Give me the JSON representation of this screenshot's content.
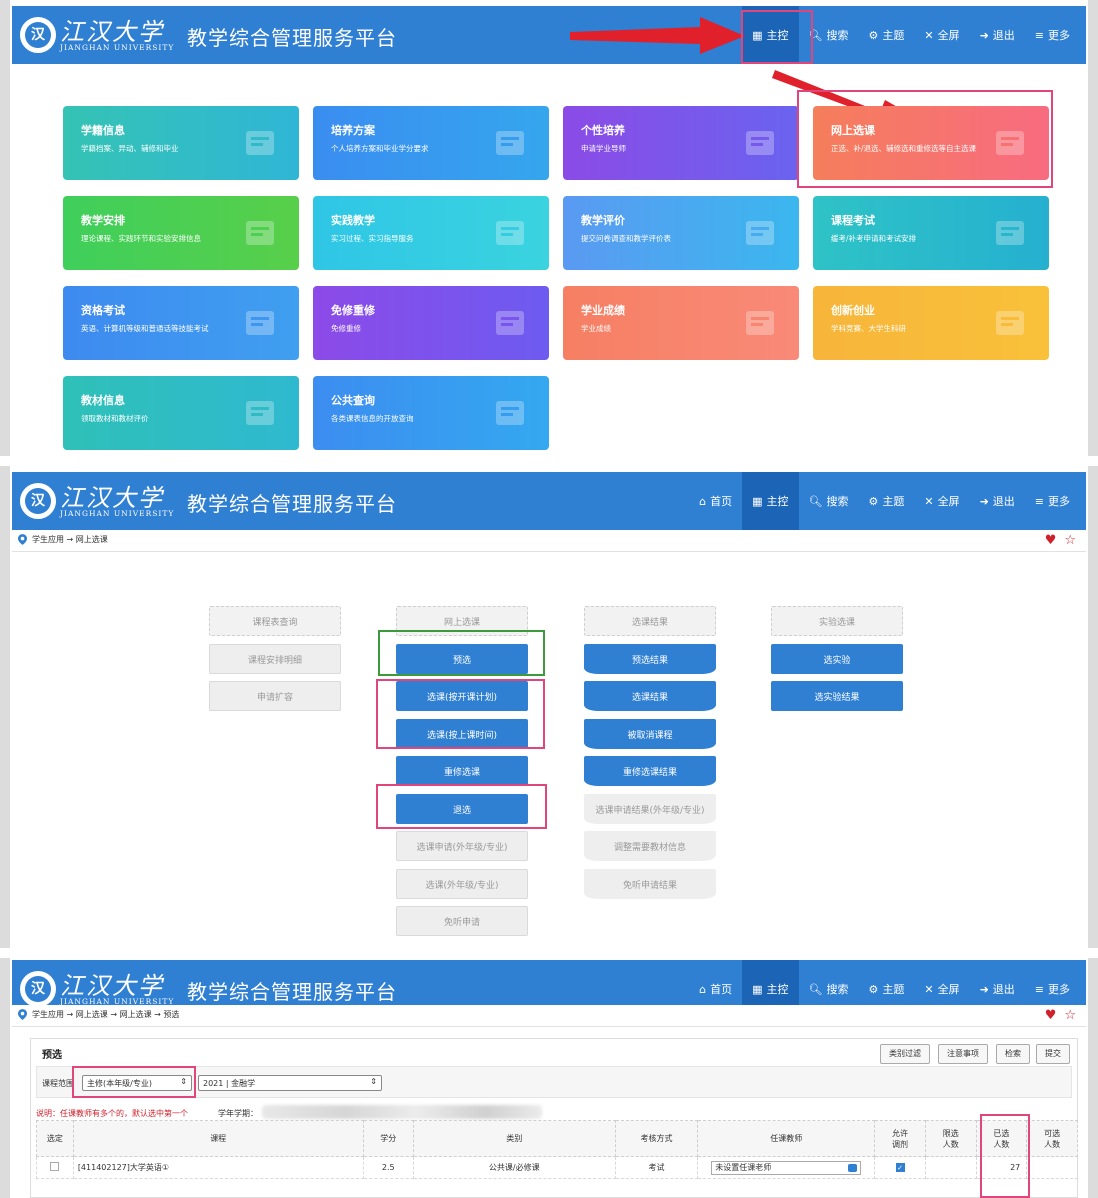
{
  "school": {
    "cn": "江汉大学",
    "en": "JIANGHAN UNIVERSITY",
    "seal": "汉"
  },
  "platform_title": "教学综合管理服务平台",
  "nav": [
    {
      "label": "首页",
      "icon": "home-icon"
    },
    {
      "label": "主控",
      "icon": "windows-icon"
    },
    {
      "label": "搜索",
      "icon": "search-icon"
    },
    {
      "label": "主题",
      "icon": "cogs-icon"
    },
    {
      "label": "全屏",
      "icon": "fullscreen-icon"
    },
    {
      "label": "退出",
      "icon": "logout-icon"
    },
    {
      "label": "更多",
      "icon": "menu-icon"
    }
  ],
  "panel1_nav_first": "首页",
  "tiles": [
    {
      "title": "学籍信息",
      "desc": "学籍档案、异动、辅修和毕业",
      "color_from": "#35c3b4",
      "color_to": "#2fb6d6"
    },
    {
      "title": "培养方案",
      "desc": "个人培养方案和毕业学分要求",
      "color_from": "#3a8df0",
      "color_to": "#35a6ee"
    },
    {
      "title": "个性培养",
      "desc": "申请学业导师",
      "color_from": "#8b4be6",
      "color_to": "#6a63f0"
    },
    {
      "title": "网上选课",
      "desc": "正选、补/退选、辅修选和重修选等自主选课",
      "color_from": "#f57e5b",
      "color_to": "#f86b80"
    },
    {
      "title": "教学安排",
      "desc": "理论课程、实践环节和实验安排信息",
      "color_from": "#3fcf5b",
      "color_to": "#58cf4a"
    },
    {
      "title": "实践教学",
      "desc": "实习过程、实习指导服务",
      "color_from": "#2fc6e6",
      "color_to": "#3ad3df"
    },
    {
      "title": "教学评价",
      "desc": "提交问卷调查和教学评价表",
      "color_from": "#5a9af2",
      "color_to": "#3bb7ee"
    },
    {
      "title": "课程考试",
      "desc": "缓考/补考申请和考试安排",
      "color_from": "#2ec3c6",
      "color_to": "#25b0d0"
    },
    {
      "title": "资格考试",
      "desc": "英语、计算机等级和普通话等技能考试",
      "color_from": "#3e8af0",
      "color_to": "#3f9ff0"
    },
    {
      "title": "免修重修",
      "desc": "免修重修",
      "color_from": "#8c4ae8",
      "color_to": "#6d5bf0"
    },
    {
      "title": "学业成绩",
      "desc": "学业成绩",
      "color_from": "#f67f63",
      "color_to": "#f98a78"
    },
    {
      "title": "创新创业",
      "desc": "学科竞赛、大学生科研",
      "color_from": "#f7b53a",
      "color_to": "#f9c13a"
    },
    {
      "title": "教材信息",
      "desc": "领取教材和教材评价",
      "color_from": "#2fc0b8",
      "color_to": "#2fb9d0"
    },
    {
      "title": "公共查询",
      "desc": "各类课表信息的开放查询",
      "color_from": "#3c8df0",
      "color_to": "#34a8f0"
    }
  ],
  "breadcrumb2": "学生应用 → 网上选课",
  "breadcrumb3": "学生应用 → 网上选课 → 网上选课 → 预选",
  "select_cols": [
    {
      "items": [
        "课程表查询",
        "课程安排明细",
        "申请扩容"
      ]
    },
    {
      "items": [
        "网上选课",
        "预选",
        "选课(按开课计划)",
        "选课(按上课时间)",
        "重修选课",
        "退选",
        "选课申请(外年级/专业)",
        "选课(外年级/专业)",
        "免听申请"
      ]
    },
    {
      "items": [
        "选课结果",
        "预选结果",
        "选课结果",
        "被取消课程",
        "重修选课结果",
        "选课申请结果(外年级/专业)",
        "调整需要教材信息",
        "免听申请结果"
      ]
    },
    {
      "items": [
        "实验选课",
        "选实验",
        "选实验结果"
      ]
    }
  ],
  "preselect": {
    "title": "预选",
    "buttons": [
      "类别过滤",
      "注意事项",
      "检索",
      "提交"
    ],
    "range_label": "课程范围",
    "range_value": "主修(本年级/专业)",
    "major_value": "2021 | 金融学",
    "note": "说明：任课教师有多个的，默认选中第一个",
    "term_label": "学年学期：",
    "headers": [
      "选定",
      "课程",
      "学分",
      "类别",
      "考核方式",
      "任课教师",
      "允许调剂",
      "限选人数",
      "已选人数",
      "可选人数"
    ],
    "rows": [
      {
        "course": "[411402127]大学英语①",
        "credit": "2.5",
        "category": "公共课/必修课",
        "exam": "考试",
        "teacher": "未设置任课老师",
        "allow": true,
        "limit": "",
        "selected": "27",
        "avail": ""
      }
    ]
  }
}
